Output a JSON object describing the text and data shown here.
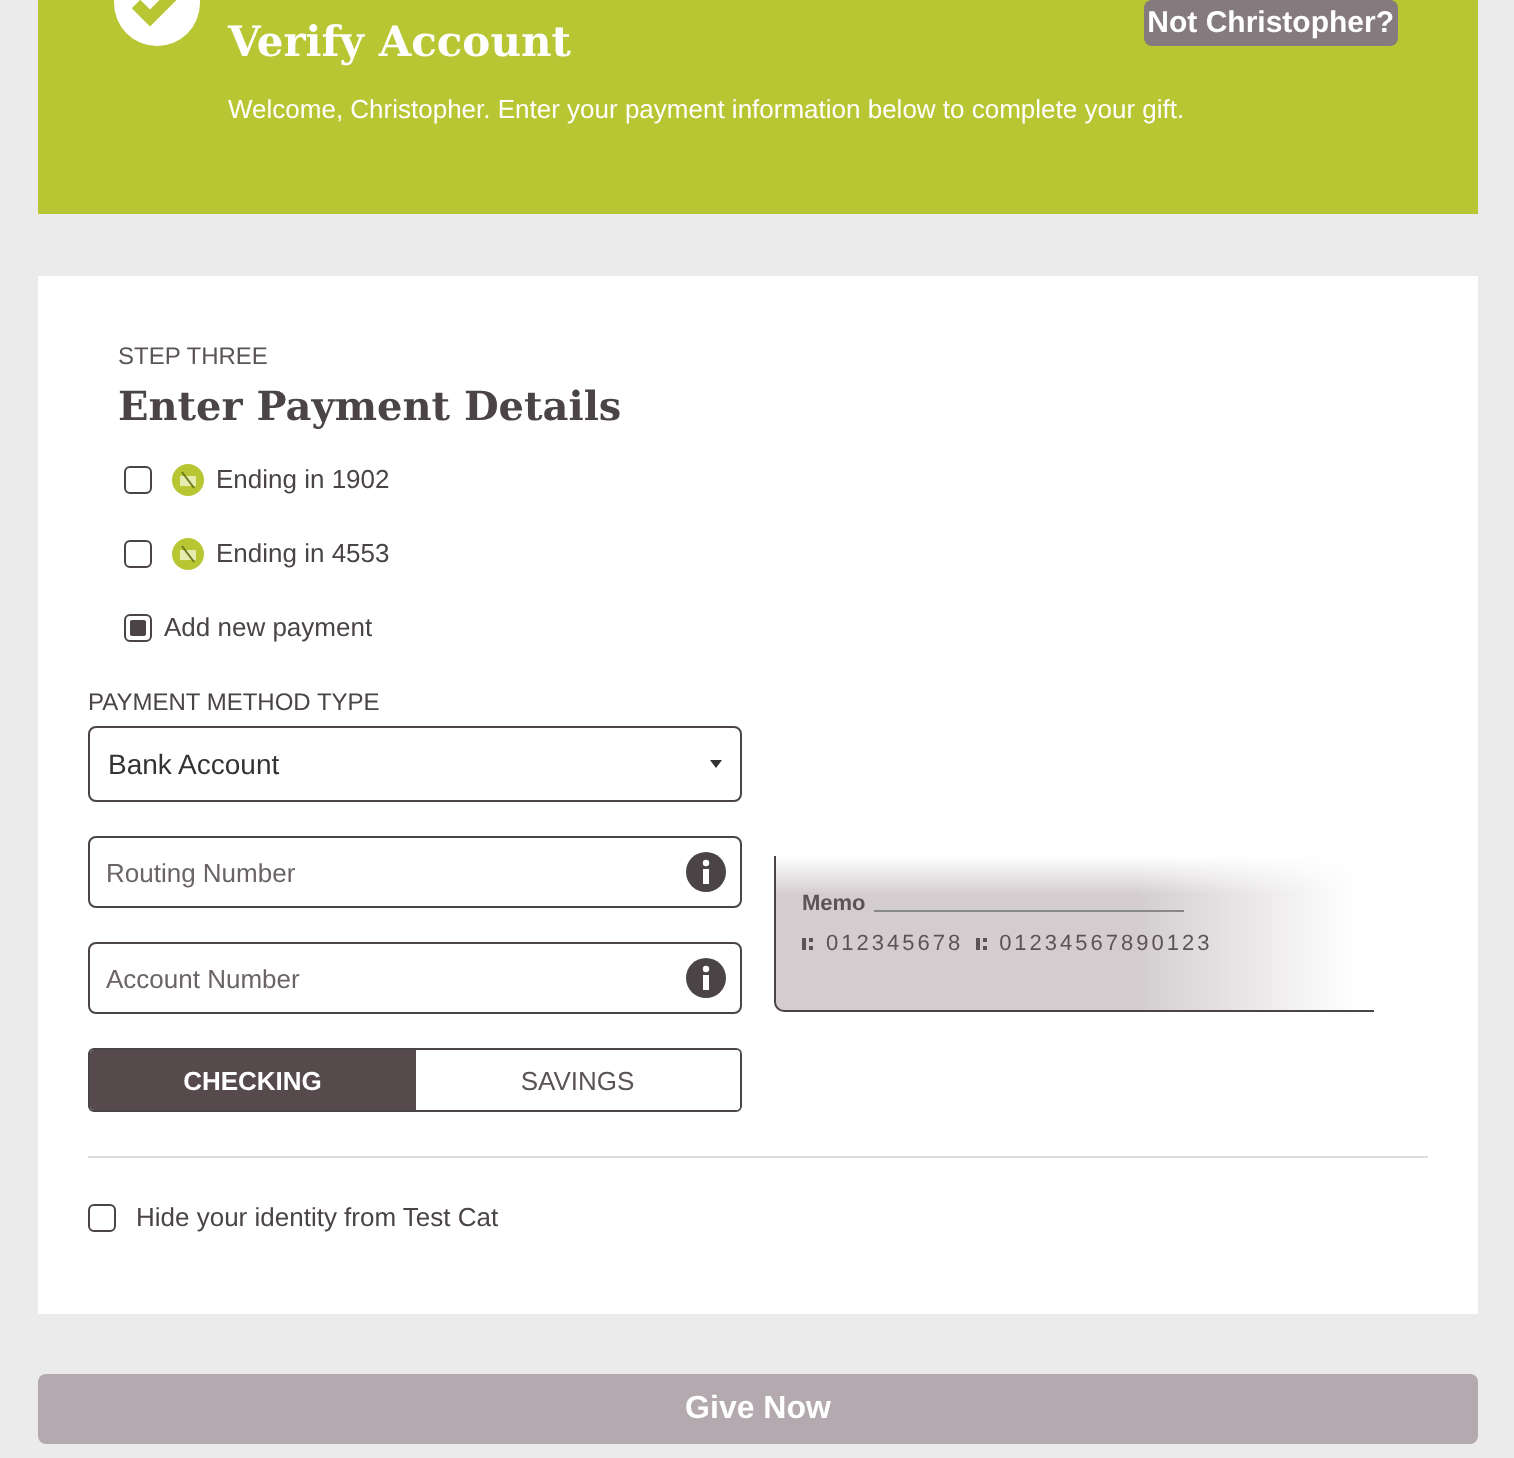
{
  "header": {
    "title": "Verify Account",
    "message": "Welcome, Christopher. Enter your payment information below to complete your gift.",
    "switch_button": "Not Christopher?"
  },
  "step": {
    "label": "STEP THREE",
    "title": "Enter Payment Details"
  },
  "payments": [
    {
      "label": "Ending in 1902",
      "kind": "saved",
      "checked": false
    },
    {
      "label": "Ending in 4553",
      "kind": "saved",
      "checked": false
    },
    {
      "label": "Add new payment",
      "kind": "new",
      "checked": true
    }
  ],
  "method": {
    "label": "PAYMENT METHOD TYPE",
    "value": "Bank Account"
  },
  "fields": [
    {
      "placeholder": "Routing Number"
    },
    {
      "placeholder": "Account Number"
    }
  ],
  "account_types": [
    {
      "label": "CHECKING",
      "selected": true
    },
    {
      "label": "SAVINGS",
      "selected": false
    }
  ],
  "check_preview": {
    "memo": "Memo",
    "routing": "012345678",
    "account": "01234567890123"
  },
  "hide_identity": {
    "label": "Hide your identity from Test Cat",
    "checked": false
  },
  "submit": {
    "label": "Give Now",
    "disabled": true
  }
}
